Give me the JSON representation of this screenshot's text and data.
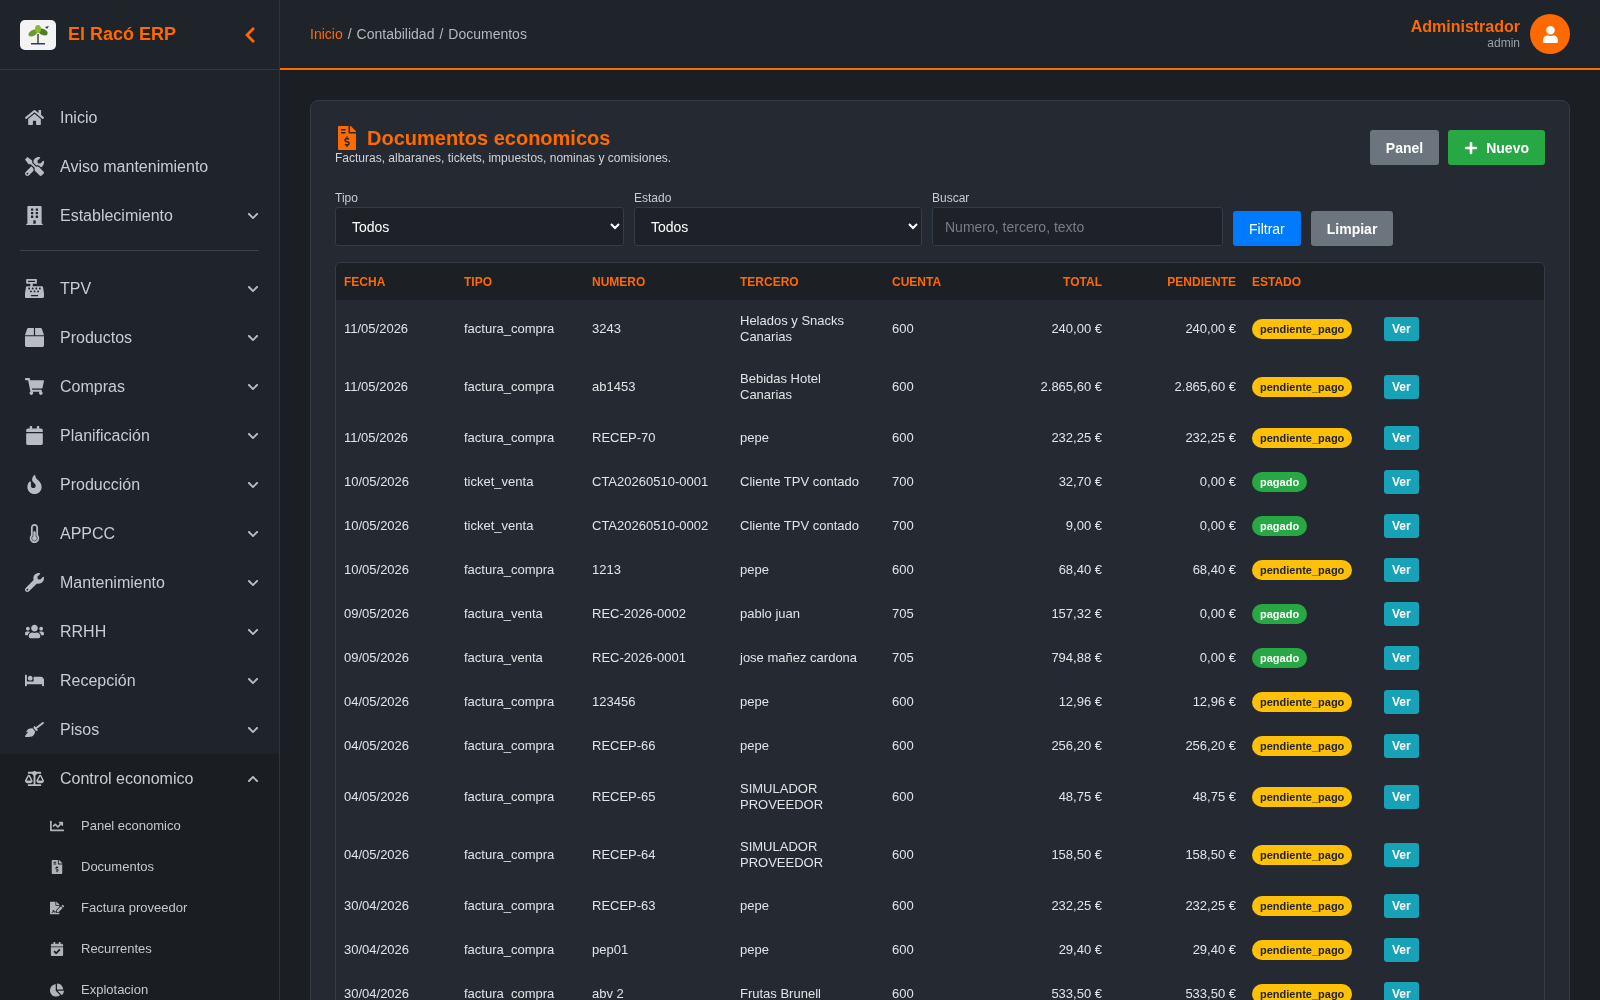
{
  "sidebar": {
    "brand": "El Racó ERP",
    "items": [
      {
        "label": "Inicio",
        "kind": "link"
      },
      {
        "label": "Aviso mantenimiento",
        "kind": "link"
      },
      {
        "label": "Establecimiento",
        "kind": "group",
        "expanded": false
      },
      {
        "kind": "divider"
      },
      {
        "label": "TPV",
        "kind": "group",
        "expanded": false
      },
      {
        "label": "Productos",
        "kind": "group",
        "expanded": false
      },
      {
        "label": "Compras",
        "kind": "group",
        "expanded": false
      },
      {
        "label": "Planificación",
        "kind": "group",
        "expanded": false
      },
      {
        "label": "Producción",
        "kind": "group",
        "expanded": false
      },
      {
        "label": "APPCC",
        "kind": "group",
        "expanded": false
      },
      {
        "label": "Mantenimiento",
        "kind": "group",
        "expanded": false
      },
      {
        "label": "RRHH",
        "kind": "group",
        "expanded": false
      },
      {
        "label": "Recepción",
        "kind": "group",
        "expanded": false
      },
      {
        "label": "Pisos",
        "kind": "group",
        "expanded": false
      },
      {
        "label": "Control economico",
        "kind": "group",
        "expanded": true,
        "children": [
          {
            "label": "Panel economico"
          },
          {
            "label": "Documentos"
          },
          {
            "label": "Factura proveedor"
          },
          {
            "label": "Recurrentes"
          },
          {
            "label": "Explotacion"
          }
        ]
      }
    ]
  },
  "header": {
    "breadcrumb": [
      {
        "kind": "link",
        "text": "Inicio"
      },
      {
        "kind": "separator",
        "text": "/"
      },
      {
        "kind": "link",
        "text": "Contabilidad"
      },
      {
        "kind": "separator",
        "text": "/"
      },
      {
        "kind": "link",
        "text": "Documentos"
      }
    ],
    "user": {
      "name": "Administrador",
      "role": "admin"
    }
  },
  "page": {
    "title": "Documentos economicos",
    "subtitle": "Facturas, albaranes, tickets, impuestos, nominas y comisiones.",
    "buttons": [
      "Panel",
      "Nuevo"
    ],
    "filters": {
      "tipo": {
        "label": "Tipo",
        "value": "Todos"
      },
      "estado": {
        "label": "Estado",
        "value": "Todos"
      },
      "buscar": {
        "label": "Buscar",
        "placeholder": "Numero, tercero, texto"
      },
      "buttons": [
        "Filtrar",
        "Limpiar"
      ]
    }
  },
  "table": {
    "columns": [
      "FECHA",
      "TIPO",
      "NUMERO",
      "TERCERO",
      "CUENTA",
      "TOTAL",
      "PENDIENTE",
      "ESTADO"
    ],
    "rows": [
      {
        "cells": [
          "11/05/2026",
          "factura_compra",
          "3243",
          "Helados y Snacks Canarias",
          "600",
          "240,00 €",
          "240,00 €"
        ],
        "estado": "pendiente_pago",
        "color": "#ffc107",
        "action": "Ver"
      },
      {
        "cells": [
          "11/05/2026",
          "factura_compra",
          "ab1453",
          "Bebidas Hotel Canarias",
          "600",
          "2.865,60 €",
          "2.865,60 €"
        ],
        "estado": "pendiente_pago",
        "color": "#ffc107",
        "action": "Ver"
      },
      {
        "cells": [
          "11/05/2026",
          "factura_compra",
          "RECEP-70",
          "pepe",
          "600",
          "232,25 €",
          "232,25 €"
        ],
        "estado": "pendiente_pago",
        "color": "#ffc107",
        "action": "Ver"
      },
      {
        "cells": [
          "10/05/2026",
          "ticket_venta",
          "CTA20260510-0001",
          "Cliente TPV contado",
          "700",
          "32,70 €",
          "0,00 €"
        ],
        "estado": "pagado",
        "color": "#28a745",
        "action": "Ver"
      },
      {
        "cells": [
          "10/05/2026",
          "ticket_venta",
          "CTA20260510-0002",
          "Cliente TPV contado",
          "700",
          "9,00 €",
          "0,00 €"
        ],
        "estado": "pagado",
        "color": "#28a745",
        "action": "Ver"
      },
      {
        "cells": [
          "10/05/2026",
          "factura_compra",
          "1213",
          "pepe",
          "600",
          "68,40 €",
          "68,40 €"
        ],
        "estado": "pendiente_pago",
        "color": "#ffc107",
        "action": "Ver"
      },
      {
        "cells": [
          "09/05/2026",
          "factura_venta",
          "REC-2026-0002",
          "pablo juan",
          "705",
          "157,32 €",
          "0,00 €"
        ],
        "estado": "pagado",
        "color": "#28a745",
        "action": "Ver"
      },
      {
        "cells": [
          "09/05/2026",
          "factura_venta",
          "REC-2026-0001",
          "jose mañez cardona",
          "705",
          "794,88 €",
          "0,00 €"
        ],
        "estado": "pagado",
        "color": "#28a745",
        "action": "Ver"
      },
      {
        "cells": [
          "04/05/2026",
          "factura_compra",
          "123456",
          "pepe",
          "600",
          "12,96 €",
          "12,96 €"
        ],
        "estado": "pendiente_pago",
        "color": "#ffc107",
        "action": "Ver"
      },
      {
        "cells": [
          "04/05/2026",
          "factura_compra",
          "RECEP-66",
          "pepe",
          "600",
          "256,20 €",
          "256,20 €"
        ],
        "estado": "pendiente_pago",
        "color": "#ffc107",
        "action": "Ver"
      },
      {
        "cells": [
          "04/05/2026",
          "factura_compra",
          "RECEP-65",
          "SIMULADOR PROVEEDOR",
          "600",
          "48,75 €",
          "48,75 €"
        ],
        "estado": "pendiente_pago",
        "color": "#ffc107",
        "action": "Ver"
      },
      {
        "cells": [
          "04/05/2026",
          "factura_compra",
          "RECEP-64",
          "SIMULADOR PROVEEDOR",
          "600",
          "158,50 €",
          "158,50 €"
        ],
        "estado": "pendiente_pago",
        "color": "#ffc107",
        "action": "Ver"
      },
      {
        "cells": [
          "30/04/2026",
          "factura_compra",
          "RECEP-63",
          "pepe",
          "600",
          "232,25 €",
          "232,25 €"
        ],
        "estado": "pendiente_pago",
        "color": "#ffc107",
        "action": "Ver"
      },
      {
        "cells": [
          "30/04/2026",
          "factura_compra",
          "pep01",
          "pepe",
          "600",
          "29,40 €",
          "29,40 €"
        ],
        "estado": "pendiente_pago",
        "color": "#ffc107",
        "action": "Ver"
      },
      {
        "cells": [
          "30/04/2026",
          "factura_compra",
          "abv 2",
          "Frutas Brunell",
          "600",
          "533,50 €",
          "533,50 €"
        ],
        "estado": "pendiente_pago",
        "color": "#ffc107",
        "action": "Ver"
      }
    ]
  }
}
